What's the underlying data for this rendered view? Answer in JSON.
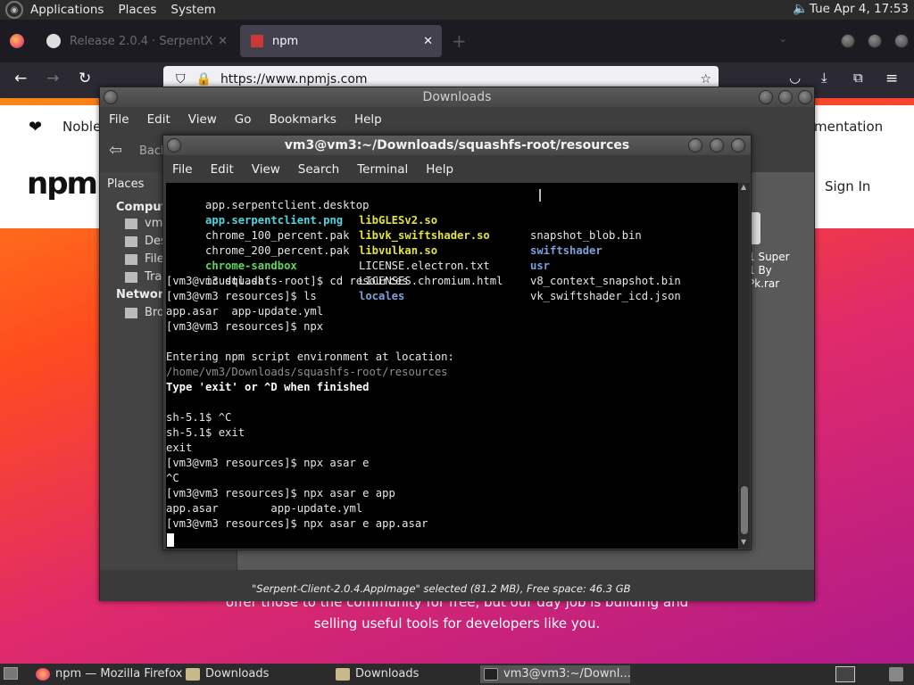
{
  "top_panel": {
    "menus": [
      "Applications",
      "Places",
      "System"
    ],
    "clock": "Tue Apr  4, 17:53"
  },
  "firefox": {
    "tabs": [
      {
        "label": "Release 2.0.4 · SerpentX"
      },
      {
        "label": "npm"
      }
    ],
    "url": "https://www.npmjs.com",
    "page": {
      "nav_fragment_left": "Noble",
      "nav_fragment_right": "mentation",
      "logo": "npm",
      "sign_in": "Sign In",
      "body_line1": "offer those to the community for free, but our day job is building and",
      "body_line2": "selling useful tools for developers like you.",
      "heart": "❤"
    }
  },
  "nautilus": {
    "title": "Downloads",
    "menus": [
      "File",
      "Edit",
      "View",
      "Go",
      "Bookmarks",
      "Help"
    ],
    "back": "Back",
    "sidebar": {
      "header": "Places",
      "computer_header": "Computer",
      "items": [
        "vm3",
        "Desktop",
        "File System",
        "Trash"
      ],
      "network_header": "Network",
      "network_items": [
        "Browse Network"
      ]
    },
    "file_fragment": [
      "1 Super",
      "1 By",
      "Pk.rar"
    ],
    "status": "\"Serpent-Client-2.0.4.AppImage\" selected (81.2 MB), Free space: 46.3 GB"
  },
  "terminal": {
    "title": "vm3@vm3:~/Downloads/squashfs-root/resources",
    "menus": [
      "File",
      "Edit",
      "View",
      "Search",
      "Terminal",
      "Help"
    ],
    "listing": [
      [
        "app.serpentclient.desktop",
        "libGLESv2.so",
        "snapshot_blob.bin"
      ],
      [
        "app.serpentclient.png",
        "libvk_swiftshader.so",
        "swiftshader"
      ],
      [
        "chrome_100_percent.pak",
        "libvulkan.so",
        "usr"
      ],
      [
        "chrome_200_percent.pak",
        "LICENSE.electron.txt",
        "v8_context_snapshot.bin"
      ],
      [
        "chrome-sandbox",
        "LICENSES.chromium.html",
        "vk_swiftshader_icd.json"
      ],
      [
        "icudtl.dat",
        "locales",
        ""
      ]
    ],
    "lines": [
      "[vm3@vm3 squashfs-root]$ cd resources",
      "[vm3@vm3 resources]$ ls",
      "app.asar  app-update.yml",
      "[vm3@vm3 resources]$ npx",
      "",
      "Entering npm script environment at location:",
      "/home/vm3/Downloads/squashfs-root/resources",
      "Type 'exit' or ^D when finished",
      "",
      "sh-5.1$ ^C",
      "sh-5.1$ exit",
      "exit",
      "[vm3@vm3 resources]$ npx asar e",
      "^C",
      "[vm3@vm3 resources]$ npx asar e app",
      "app.asar        app-update.yml",
      "[vm3@vm3 resources]$ npx asar e app.asar"
    ]
  },
  "bottom_panel": {
    "tasks": [
      "npm — Mozilla Firefox",
      "Downloads",
      "Downloads",
      "vm3@vm3:~/Downl..."
    ]
  }
}
